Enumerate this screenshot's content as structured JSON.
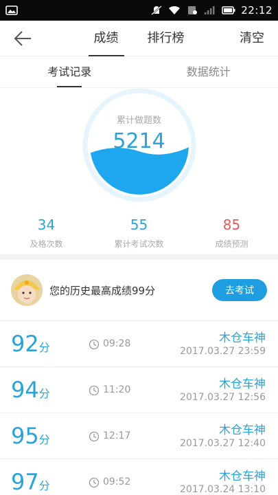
{
  "status_bar": {
    "time": "22:12",
    "icons": [
      "image-notification-icon",
      "mute-icon",
      "wifi-icon",
      "sim-icon",
      "signal-icon",
      "battery-icon"
    ]
  },
  "header": {
    "back_icon": "arrow-left-icon",
    "tabs": [
      {
        "label": "成绩",
        "active": true
      },
      {
        "label": "排行榜",
        "active": false
      }
    ],
    "action_label": "清空"
  },
  "sub_tabs": [
    {
      "label": "考试记录",
      "active": true
    },
    {
      "label": "数据统计",
      "active": false
    }
  ],
  "gauge": {
    "caption": "累计做题数",
    "value": "5214",
    "fill_level": 0.45,
    "color": "#1ea7ef"
  },
  "stats": [
    {
      "value": "34",
      "label": "及格次数",
      "color": "#2aa3d9"
    },
    {
      "value": "55",
      "label": "累计考试次数",
      "color": "#2aa3d9"
    },
    {
      "value": "85",
      "label": "成绩预测",
      "color": "#e05a5a"
    }
  ],
  "best": {
    "text": "您的历史最高成绩99分",
    "button_label": "去考试"
  },
  "records": [
    {
      "score": "92",
      "unit": "分",
      "duration": "09:28",
      "name": "木仓车神",
      "date": "2017.03.27  23:59"
    },
    {
      "score": "94",
      "unit": "分",
      "duration": "11:20",
      "name": "木仓车神",
      "date": "2017.03.27  12:56"
    },
    {
      "score": "95",
      "unit": "分",
      "duration": "12:17",
      "name": "木仓车神",
      "date": "2017.03.27  12:40"
    },
    {
      "score": "97",
      "unit": "分",
      "duration": "09:52",
      "name": "木仓车神",
      "date": "2017.03.24  13:10"
    }
  ]
}
